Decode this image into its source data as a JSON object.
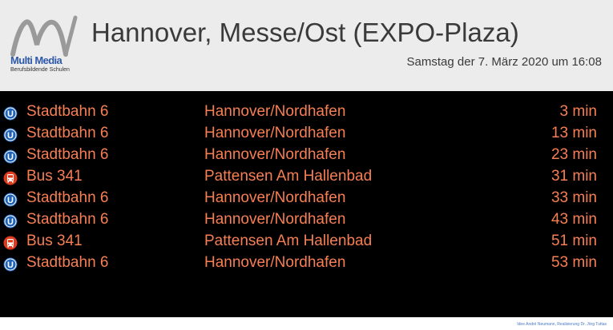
{
  "logo": {
    "title": "Multi Media",
    "subtitle": "Berufsbildende Schulen"
  },
  "header": {
    "title": "Hannover, Messe/Ost (EXPO-Plaza)",
    "datetime": "Samstag der 7. März 2020 um 16:08"
  },
  "departures": [
    {
      "icon": "ubahn-icon",
      "line": "Stadtbahn 6",
      "destination": "Hannover/Nordhafen",
      "time": "3 min"
    },
    {
      "icon": "ubahn-icon",
      "line": "Stadtbahn 6",
      "destination": "Hannover/Nordhafen",
      "time": "13 min"
    },
    {
      "icon": "ubahn-icon",
      "line": "Stadtbahn 6",
      "destination": "Hannover/Nordhafen",
      "time": "23 min"
    },
    {
      "icon": "bus-icon",
      "line": "Bus 341",
      "destination": "Pattensen Am Hallenbad",
      "time": "31 min"
    },
    {
      "icon": "ubahn-icon",
      "line": "Stadtbahn 6",
      "destination": "Hannover/Nordhafen",
      "time": "33 min"
    },
    {
      "icon": "ubahn-icon",
      "line": "Stadtbahn 6",
      "destination": "Hannover/Nordhafen",
      "time": "43 min"
    },
    {
      "icon": "bus-icon",
      "line": "Bus 341",
      "destination": "Pattensen Am Hallenbad",
      "time": "51 min"
    },
    {
      "icon": "ubahn-icon",
      "line": "Stadtbahn 6",
      "destination": "Hannover/Nordhafen",
      "time": "53 min"
    }
  ],
  "footer": {
    "credit": "Idee André Neumann, Realisierung Dr. Jörg Tuttas"
  },
  "colors": {
    "text_accent": "#f77f53",
    "ubahn_blue": "#1f64b8",
    "bus_red": "#e03b1c"
  }
}
